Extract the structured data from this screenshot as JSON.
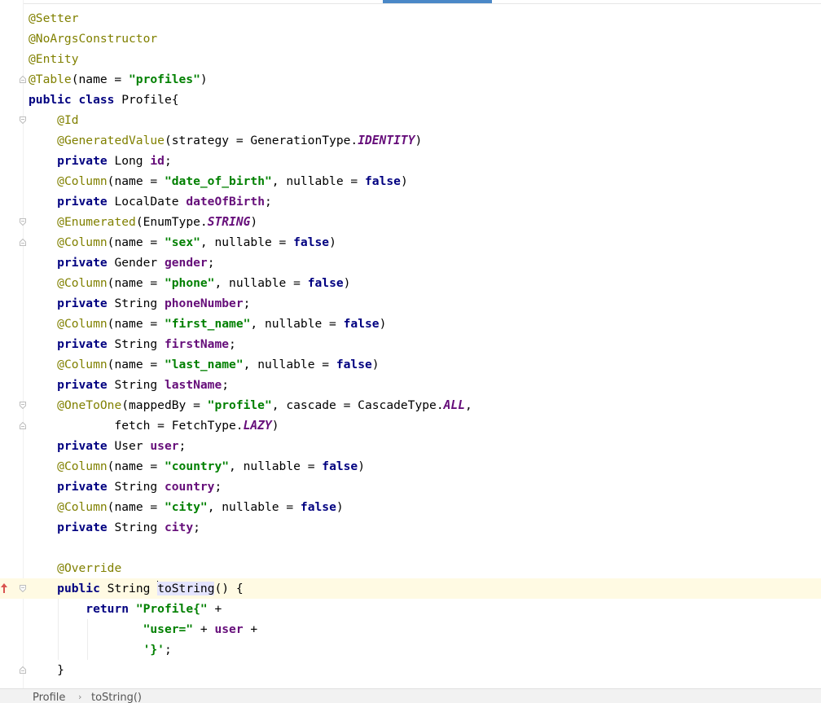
{
  "editor": {
    "scroll_indicator_color": "#4a88c7",
    "lines": [
      {
        "tokens": [
          [
            "ann",
            "@Setter"
          ]
        ]
      },
      {
        "tokens": [
          [
            "ann",
            "@NoArgsConstructor"
          ]
        ]
      },
      {
        "tokens": [
          [
            "ann",
            "@Entity"
          ]
        ]
      },
      {
        "tokens": [
          [
            "ann",
            "@Table"
          ],
          [
            "txt",
            "(name = "
          ],
          [
            "str",
            "\"profiles\""
          ],
          [
            "txt",
            ")"
          ]
        ]
      },
      {
        "tokens": [
          [
            "kw",
            "public class "
          ],
          [
            "txt",
            "Profile{"
          ]
        ]
      },
      {
        "tokens": [
          [
            "txt",
            "    "
          ],
          [
            "ann",
            "@Id"
          ]
        ]
      },
      {
        "tokens": [
          [
            "txt",
            "    "
          ],
          [
            "ann",
            "@GeneratedValue"
          ],
          [
            "txt",
            "(strategy = GenerationType."
          ],
          [
            "cst",
            "IDENTITY"
          ],
          [
            "txt",
            ")"
          ]
        ]
      },
      {
        "tokens": [
          [
            "txt",
            "    "
          ],
          [
            "kw",
            "private "
          ],
          [
            "txt",
            "Long "
          ],
          [
            "fld",
            "id"
          ],
          [
            "txt",
            ";"
          ]
        ]
      },
      {
        "tokens": [
          [
            "txt",
            "    "
          ],
          [
            "ann",
            "@Column"
          ],
          [
            "txt",
            "(name = "
          ],
          [
            "str",
            "\"date_of_birth\""
          ],
          [
            "txt",
            ", nullable = "
          ],
          [
            "kw",
            "false"
          ],
          [
            "txt",
            ")"
          ]
        ]
      },
      {
        "tokens": [
          [
            "txt",
            "    "
          ],
          [
            "kw",
            "private "
          ],
          [
            "txt",
            "LocalDate "
          ],
          [
            "fld",
            "dateOfBirth"
          ],
          [
            "txt",
            ";"
          ]
        ]
      },
      {
        "tokens": [
          [
            "txt",
            "    "
          ],
          [
            "ann",
            "@Enumerated"
          ],
          [
            "txt",
            "(EnumType."
          ],
          [
            "cst",
            "STRING"
          ],
          [
            "txt",
            ")"
          ]
        ]
      },
      {
        "tokens": [
          [
            "txt",
            "    "
          ],
          [
            "ann",
            "@Column"
          ],
          [
            "txt",
            "(name = "
          ],
          [
            "str",
            "\"sex\""
          ],
          [
            "txt",
            ", nullable = "
          ],
          [
            "kw",
            "false"
          ],
          [
            "txt",
            ")"
          ]
        ]
      },
      {
        "tokens": [
          [
            "txt",
            "    "
          ],
          [
            "kw",
            "private "
          ],
          [
            "txt",
            "Gender "
          ],
          [
            "fld",
            "gender"
          ],
          [
            "txt",
            ";"
          ]
        ]
      },
      {
        "tokens": [
          [
            "txt",
            "    "
          ],
          [
            "ann",
            "@Column"
          ],
          [
            "txt",
            "(name = "
          ],
          [
            "str",
            "\"phone\""
          ],
          [
            "txt",
            ", nullable = "
          ],
          [
            "kw",
            "false"
          ],
          [
            "txt",
            ")"
          ]
        ]
      },
      {
        "tokens": [
          [
            "txt",
            "    "
          ],
          [
            "kw",
            "private "
          ],
          [
            "txt",
            "String "
          ],
          [
            "fld",
            "phoneNumber"
          ],
          [
            "txt",
            ";"
          ]
        ]
      },
      {
        "tokens": [
          [
            "txt",
            "    "
          ],
          [
            "ann",
            "@Column"
          ],
          [
            "txt",
            "(name = "
          ],
          [
            "str",
            "\"first_name\""
          ],
          [
            "txt",
            ", nullable = "
          ],
          [
            "kw",
            "false"
          ],
          [
            "txt",
            ")"
          ]
        ]
      },
      {
        "tokens": [
          [
            "txt",
            "    "
          ],
          [
            "kw",
            "private "
          ],
          [
            "txt",
            "String "
          ],
          [
            "fld",
            "firstName"
          ],
          [
            "txt",
            ";"
          ]
        ]
      },
      {
        "tokens": [
          [
            "txt",
            "    "
          ],
          [
            "ann",
            "@Column"
          ],
          [
            "txt",
            "(name = "
          ],
          [
            "str",
            "\"last_name\""
          ],
          [
            "txt",
            ", nullable = "
          ],
          [
            "kw",
            "false"
          ],
          [
            "txt",
            ")"
          ]
        ]
      },
      {
        "tokens": [
          [
            "txt",
            "    "
          ],
          [
            "kw",
            "private "
          ],
          [
            "txt",
            "String "
          ],
          [
            "fld",
            "lastName"
          ],
          [
            "txt",
            ";"
          ]
        ]
      },
      {
        "tokens": [
          [
            "txt",
            "    "
          ],
          [
            "ann",
            "@OneToOne"
          ],
          [
            "txt",
            "(mappedBy = "
          ],
          [
            "str",
            "\"profile\""
          ],
          [
            "txt",
            ", cascade = CascadeType."
          ],
          [
            "cst",
            "ALL"
          ],
          [
            "txt",
            ","
          ]
        ]
      },
      {
        "tokens": [
          [
            "txt",
            "            fetch = FetchType."
          ],
          [
            "cst",
            "LAZY"
          ],
          [
            "txt",
            ")"
          ]
        ]
      },
      {
        "tokens": [
          [
            "txt",
            "    "
          ],
          [
            "kw",
            "private "
          ],
          [
            "txt",
            "User "
          ],
          [
            "fld",
            "user"
          ],
          [
            "txt",
            ";"
          ]
        ]
      },
      {
        "tokens": [
          [
            "txt",
            "    "
          ],
          [
            "ann",
            "@Column"
          ],
          [
            "txt",
            "(name = "
          ],
          [
            "str",
            "\"country\""
          ],
          [
            "txt",
            ", nullable = "
          ],
          [
            "kw",
            "false"
          ],
          [
            "txt",
            ")"
          ]
        ]
      },
      {
        "tokens": [
          [
            "txt",
            "    "
          ],
          [
            "kw",
            "private "
          ],
          [
            "txt",
            "String "
          ],
          [
            "fld",
            "country"
          ],
          [
            "txt",
            ";"
          ]
        ]
      },
      {
        "tokens": [
          [
            "txt",
            "    "
          ],
          [
            "ann",
            "@Column"
          ],
          [
            "txt",
            "(name = "
          ],
          [
            "str",
            "\"city\""
          ],
          [
            "txt",
            ", nullable = "
          ],
          [
            "kw",
            "false"
          ],
          [
            "txt",
            ")"
          ]
        ]
      },
      {
        "tokens": [
          [
            "txt",
            "    "
          ],
          [
            "kw",
            "private "
          ],
          [
            "txt",
            "String "
          ],
          [
            "fld",
            "city"
          ],
          [
            "txt",
            ";"
          ]
        ]
      },
      {
        "tokens": []
      },
      {
        "tokens": [
          [
            "txt",
            "    "
          ],
          [
            "ann",
            "@Override"
          ]
        ]
      },
      {
        "tokens": [
          [
            "txt",
            "    "
          ],
          [
            "kw",
            "public "
          ],
          [
            "txt",
            "String "
          ],
          [
            "caret",
            ""
          ],
          [
            "meth",
            "toString"
          ],
          [
            "txt",
            "() {"
          ]
        ],
        "current": true
      },
      {
        "tokens": [
          [
            "txt",
            "        "
          ],
          [
            "kw",
            "return "
          ],
          [
            "str",
            "\"Profile{\""
          ],
          [
            "txt",
            " +"
          ]
        ]
      },
      {
        "tokens": [
          [
            "txt",
            "                "
          ],
          [
            "str",
            "\"user=\""
          ],
          [
            "txt",
            " + "
          ],
          [
            "fld",
            "user"
          ],
          [
            "txt",
            " +"
          ]
        ]
      },
      {
        "tokens": [
          [
            "txt",
            "                "
          ],
          [
            "str",
            "'}'"
          ],
          [
            "txt",
            ";"
          ]
        ]
      },
      {
        "tokens": [
          [
            "txt",
            "    }"
          ]
        ]
      }
    ],
    "fold_markers": [
      3,
      5,
      10,
      11,
      19,
      20,
      28,
      32
    ],
    "fold_open_markers": [
      5,
      10,
      19,
      28
    ],
    "override_marker_line": 28
  },
  "breadcrumb": {
    "items": [
      "Profile",
      "toString()"
    ],
    "separator": "›"
  }
}
